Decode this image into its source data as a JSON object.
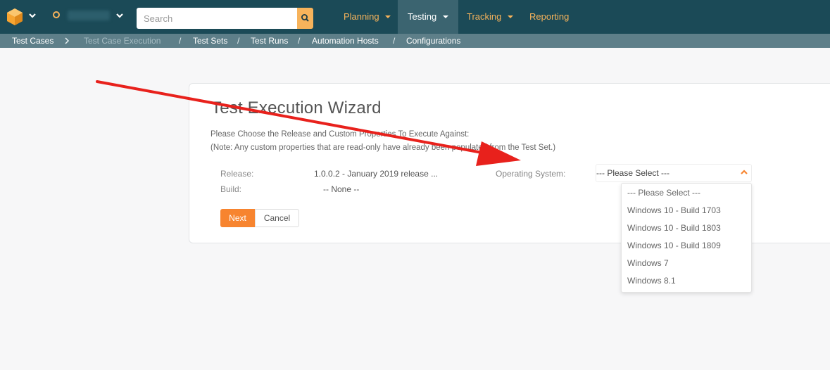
{
  "header": {
    "search_placeholder": "Search",
    "nav": [
      {
        "label": "Planning"
      },
      {
        "label": "Testing"
      },
      {
        "label": "Tracking"
      },
      {
        "label": "Reporting"
      }
    ]
  },
  "breadcrumb": {
    "items": [
      "Test Cases",
      "Test Case Execution",
      "Test Sets",
      "Test Runs",
      "Automation Hosts",
      "Configurations"
    ]
  },
  "wizard": {
    "title": "Test Execution Wizard",
    "instruction": "Please Choose the Release and Custom Properties To Execute Against:",
    "note": "(Note: Any custom properties that are read-only have already been populated from the Test Set.)",
    "release_label": "Release:",
    "release_value": "1.0.0.2 - January 2019 release ...",
    "build_label": "Build:",
    "build_value": "-- None --",
    "os_label": "Operating System:",
    "os_selected": "--- Please Select ---",
    "os_options": [
      "--- Please Select ---",
      "Windows 10 - Build 1703",
      "Windows 10 - Build 1803",
      "Windows 10 - Build 1809",
      "Windows 7",
      "Windows 8.1"
    ],
    "next_label": "Next",
    "cancel_label": "Cancel"
  },
  "colors": {
    "topbar": "#1b4a57",
    "subbar": "#5e7f89",
    "accent": "#f7b35b",
    "primary_button": "#f7842f",
    "arrow": "#e8211c"
  },
  "icons": {
    "logo": "app-logo-icon",
    "search": "search-icon",
    "dropdown": "chevron-down-icon",
    "select_toggle": "chevron-up-icon"
  }
}
